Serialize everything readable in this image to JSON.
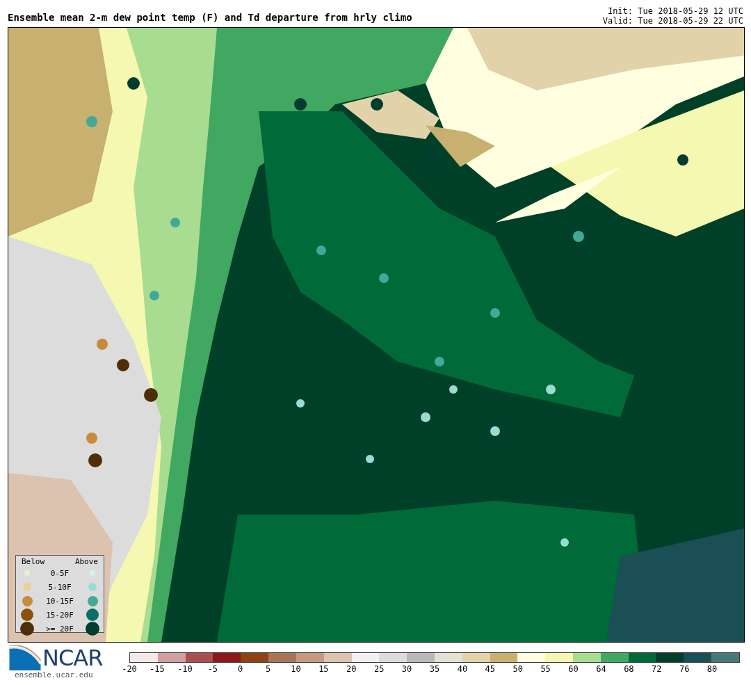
{
  "header": {
    "title": "Ensemble mean 2-m dew point temp (F) and Td departure from hrly climo",
    "init": "Init: Tue 2018-05-29 12 UTC",
    "valid": "Valid: Tue 2018-05-29 22 UTC"
  },
  "legend": {
    "below_label": "Below",
    "above_label": "Above",
    "rows": [
      {
        "label": "0-5F",
        "below": {
          "color": "#f2e8d0"
        },
        "above": {
          "color": "#d8f0ee"
        }
      },
      {
        "label": "5-10F",
        "below": {
          "color": "#ebd090"
        },
        "above": {
          "color": "#98dcd4"
        }
      },
      {
        "label": "10-15F",
        "below": {
          "color": "#c88a3c"
        },
        "above": {
          "color": "#44a898"
        }
      },
      {
        "label": "15-20F",
        "below": {
          "color": "#8c520c"
        },
        "above": {
          "color": "#087068"
        }
      },
      {
        "label": ">= 20F",
        "below": {
          "color": "#4f2d08"
        },
        "above": {
          "color": "#033c30"
        }
      }
    ]
  },
  "logo": {
    "text": "NCAR",
    "url": "ensemble.ucar.edu"
  },
  "colorbar": {
    "bins": [
      {
        "color": "#f5e8e8"
      },
      {
        "color": "#d0a0a0"
      },
      {
        "color": "#a85050"
      },
      {
        "color": "#8b1a1a"
      },
      {
        "color": "#8b4513"
      },
      {
        "color": "#a87555"
      },
      {
        "color": "#c49a80"
      },
      {
        "color": "#dcc3b0"
      },
      {
        "color": "#f0f0f0"
      },
      {
        "color": "#dcdcdc"
      },
      {
        "color": "#b8b8b8"
      },
      {
        "color": "#e2e2d2"
      },
      {
        "color": "#e2d2aa"
      },
      {
        "color": "#c8b070"
      },
      {
        "color": "#ffffe0"
      },
      {
        "color": "#f5f8b0"
      },
      {
        "color": "#a8dc90"
      },
      {
        "color": "#40a860"
      },
      {
        "color": "#006a38"
      },
      {
        "color": "#004028"
      },
      {
        "color": "#1a4f55"
      },
      {
        "color": "#4a7878"
      }
    ],
    "ticks": [
      "-20",
      "-15",
      "-10",
      "-5",
      "0",
      "5",
      "10",
      "15",
      "20",
      "25",
      "30",
      "35",
      "40",
      "45",
      "50",
      "55",
      "60",
      "64",
      "68",
      "72",
      "76",
      "80"
    ]
  }
}
